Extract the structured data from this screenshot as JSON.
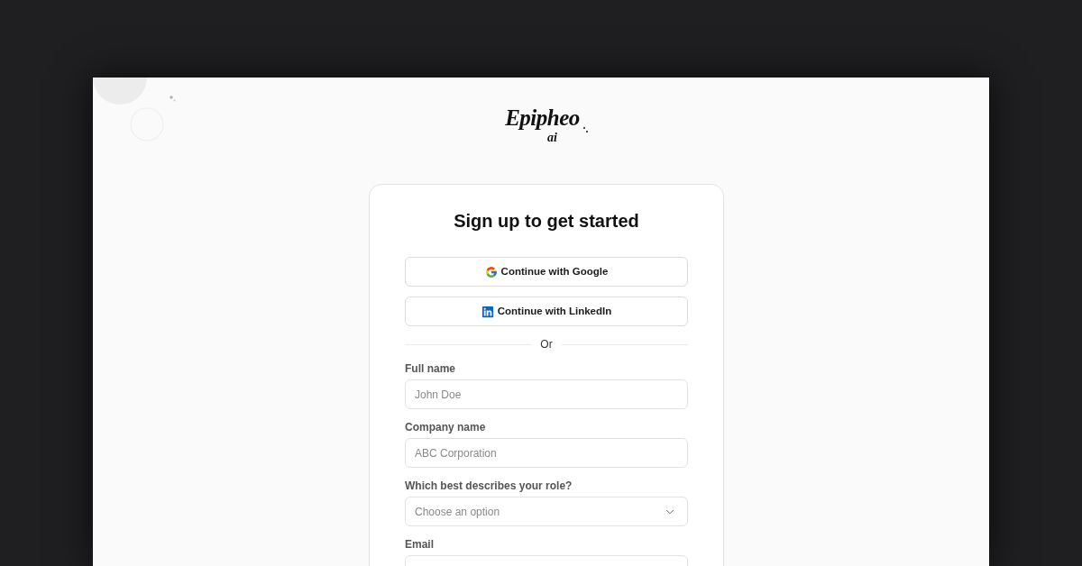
{
  "logo": {
    "wordmark": "Epipheo",
    "suffix": "ai"
  },
  "card": {
    "title": "Sign up to get started",
    "social_buttons": [
      {
        "kind": "google",
        "label": "Continue with Google"
      },
      {
        "kind": "linkedin",
        "label": "Continue with LinkedIn"
      }
    ],
    "divider": "Or",
    "fields": [
      {
        "kind": "text",
        "label": "Full name",
        "placeholder": "John Doe"
      },
      {
        "kind": "text",
        "label": "Company name",
        "placeholder": "ABC Corporation"
      },
      {
        "kind": "select",
        "label": "Which best describes your role?",
        "placeholder": "Choose an option"
      },
      {
        "kind": "text",
        "label": "Email"
      }
    ]
  }
}
